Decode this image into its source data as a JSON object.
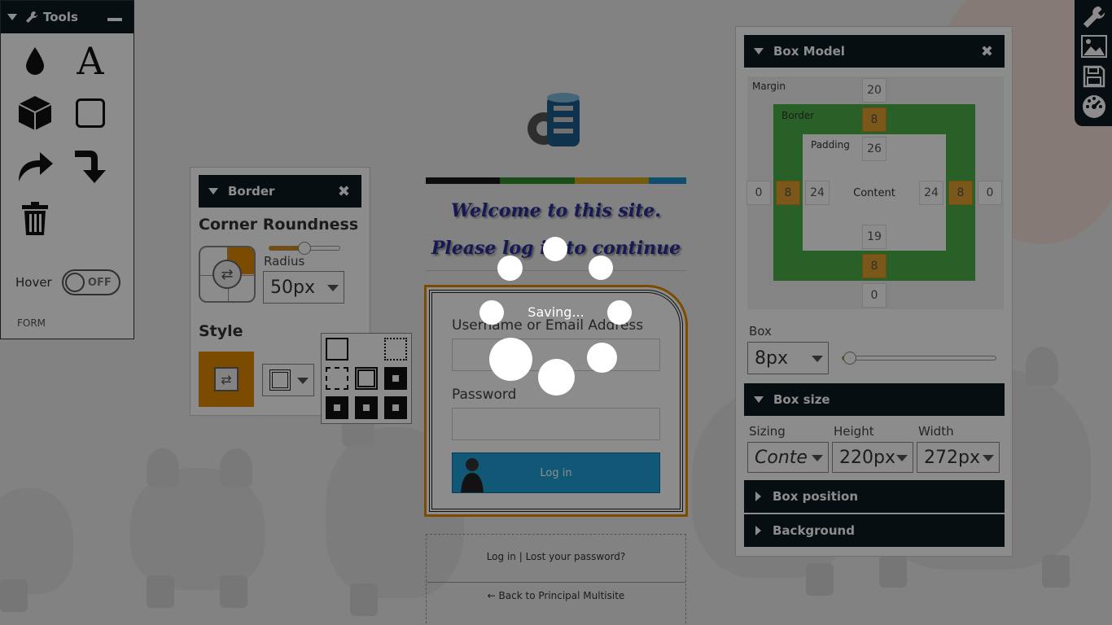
{
  "tools": {
    "title": "Tools",
    "icons": [
      "drop-icon",
      "text-icon",
      "cube-icon",
      "square-icon",
      "redo-icon",
      "turn-down-icon",
      "trash-icon"
    ],
    "hover_label": "Hover",
    "hover_state": "OFF",
    "section_label": "FORM"
  },
  "border_panel": {
    "title": "Border",
    "corner_title": "Corner Roundness",
    "radius_label": "Radius",
    "radius_value": "50px",
    "radius_slider_fraction": 0.5,
    "style_title": "Style"
  },
  "page": {
    "welcome": "Welcome to this site. Please log in to continue",
    "username_label": "Username or Email Address",
    "password_label": "Password",
    "login_button": "Log in",
    "links_top": "Log in | Lost your password?",
    "links_back": "← Back to Principal Multisite",
    "stripe_colors": [
      "#1a1a1a",
      "#2f8a2a",
      "#d9a520",
      "#1f8ec8"
    ]
  },
  "box_model": {
    "title": "Box Model",
    "margin_label": "Margin",
    "border_label": "Border",
    "padding_label": "Padding",
    "content_label": "Content",
    "margin": {
      "top": "20",
      "right": "0",
      "bottom": "0",
      "left": "0"
    },
    "border": {
      "top": "8",
      "right": "8",
      "bottom": "8",
      "left": "8"
    },
    "padding": {
      "top": "26",
      "right": "24",
      "bottom": "19",
      "left": "24"
    },
    "box_label": "Box",
    "box_value": "8px",
    "box_slider_fraction": 0.05
  },
  "box_size": {
    "title": "Box size",
    "sizing_label": "Sizing",
    "sizing_value": "Conte...",
    "height_label": "Height",
    "height_value": "220px",
    "width_label": "Width",
    "width_value": "272px"
  },
  "sections": {
    "box_position": "Box position",
    "background": "Background"
  },
  "right_sidebar": {
    "icons": [
      "wrench-icon",
      "image-icon",
      "save-icon",
      "dashboard-icon"
    ]
  },
  "loader": {
    "text": "Saving..."
  },
  "colors": {
    "panel_header": "#0e1a20",
    "accent": "#e08a00",
    "border_green": "#4cb04a"
  }
}
